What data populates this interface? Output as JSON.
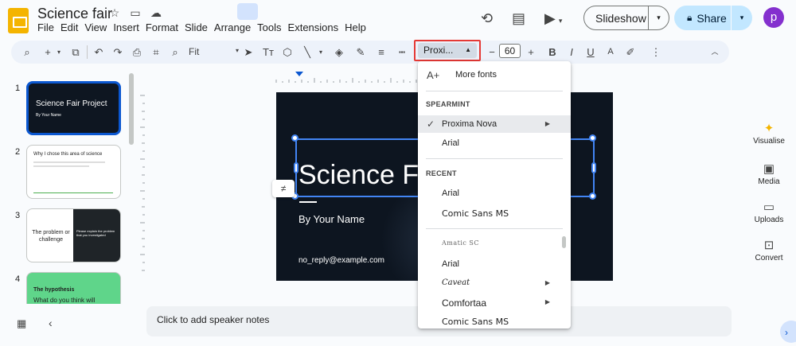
{
  "document": {
    "title": "Science fair"
  },
  "menu": [
    "File",
    "Edit",
    "View",
    "Insert",
    "Format",
    "Slide",
    "Arrange",
    "Tools",
    "Extensions",
    "Help"
  ],
  "header": {
    "slideshow_label": "Slideshow",
    "share_label": "Share",
    "avatar_initial": "p"
  },
  "toolbar": {
    "zoom_label": "Fit",
    "font_name": "Proxi...",
    "font_size": "60"
  },
  "slides": [
    {
      "number": "1",
      "title": "Science Fair Project",
      "subtitle": "By Your Name"
    },
    {
      "number": "2",
      "title": "Why I chose this area of science"
    },
    {
      "number": "3",
      "title": "The problem or challenge",
      "body": "Please explain the problem that you investigated"
    },
    {
      "number": "4",
      "title": "The hypothesis",
      "body": "What do you think will"
    }
  ],
  "current_slide": {
    "title": "Science Fair Project",
    "subtitle": "By Your Name",
    "email": "no_reply@example.com"
  },
  "notes_placeholder": "Click to add speaker notes",
  "sidebar": {
    "items": [
      "Visualise",
      "Media",
      "Uploads",
      "Convert"
    ]
  },
  "font_menu": {
    "more_fonts_label": "More fonts",
    "sections": [
      {
        "heading": "SPEARMINT",
        "items": [
          "Proxima Nova",
          "Arial"
        ]
      },
      {
        "heading": "RECENT",
        "items": [
          "Arial",
          "Comic Sans MS"
        ]
      },
      {
        "heading": "",
        "items": [
          "Amatic SC",
          "Arial",
          "Caveat",
          "Comfortaa",
          "Comic Sans MS"
        ]
      }
    ]
  },
  "colors": {
    "accent": "#0b57d0",
    "share_bg": "#c2e7ff",
    "highlight_border": "#e53935",
    "avatar": "#8430ce",
    "logo": "#f4b400"
  }
}
